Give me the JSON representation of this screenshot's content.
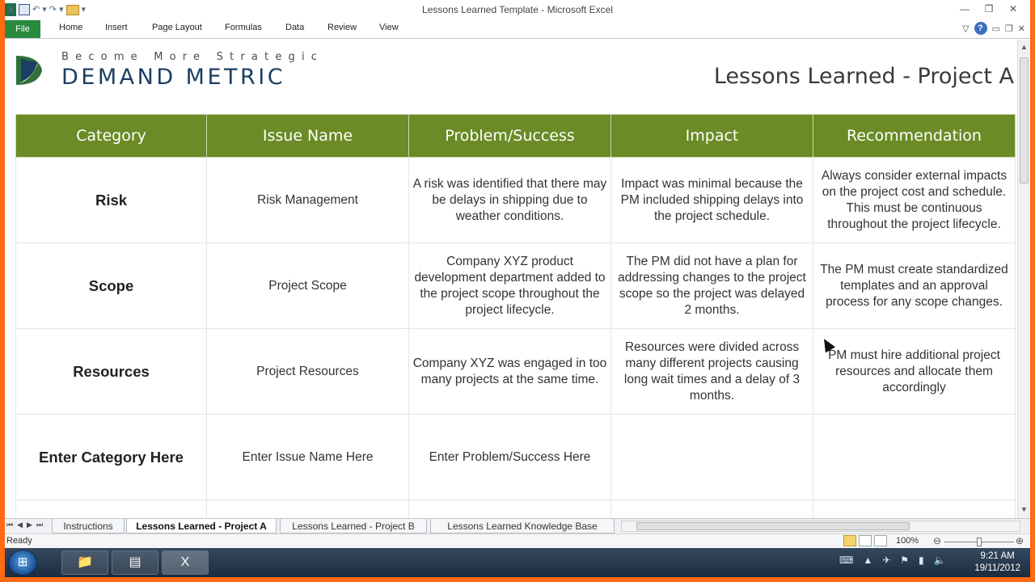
{
  "window": {
    "title": "Lessons Learned Template  -  Microsoft Excel"
  },
  "ribbon": {
    "tabs": [
      "File",
      "Home",
      "Insert",
      "Page Layout",
      "Formulas",
      "Data",
      "Review",
      "View"
    ]
  },
  "header": {
    "tagline": "Become More Strategic",
    "brand": "DEMAND METRIC",
    "title": "Lessons Learned - Project A"
  },
  "table": {
    "columns": [
      "Category",
      "Issue Name",
      "Problem/Success",
      "Impact",
      "Recommendation"
    ],
    "rows": [
      {
        "category": "Risk",
        "issue": "Risk Management",
        "problem": "A risk was identified that there may be delays in shipping due to weather conditions.",
        "impact": "Impact was minimal because the PM included shipping delays into the project schedule.",
        "recommendation": "Always consider external impacts on the project cost and schedule. This must be continuous throughout the project lifecycle."
      },
      {
        "category": "Scope",
        "issue": "Project Scope",
        "problem": "Company XYZ product development department added to the project scope throughout the project lifecycle.",
        "impact": "The PM did not have a plan for addressing changes to the project scope so the project was delayed 2 months.",
        "recommendation": "The PM must create standardized templates and an approval process for any scope changes."
      },
      {
        "category": "Resources",
        "issue": "Project Resources",
        "problem": "Company XYZ was engaged in too many projects at the same time.",
        "impact": "Resources were divided across many different projects causing long wait times and a delay of 3 months.",
        "recommendation": "PM must hire additional project resources and allocate them accordingly"
      },
      {
        "category": "Enter Category Here",
        "issue": "Enter Issue Name Here",
        "problem": "Enter Problem/Success Here",
        "impact": "",
        "recommendation": ""
      }
    ]
  },
  "sheet_tabs": {
    "tab1": "Instructions",
    "tab2": "Lessons Learned - Project A",
    "tab3": "Lessons Learned - Project B",
    "tab4": "Lessons Learned Knowledge Base"
  },
  "status": {
    "ready": "Ready",
    "zoom": "100%"
  },
  "taskbar": {
    "time": "9:21 AM",
    "date": "19/11/2012"
  },
  "colors": {
    "header_green": "#6a8b25",
    "file_tab": "#2a8a3e",
    "brand_blue": "#1b3e63",
    "frame_orange": "#ff6a13"
  }
}
